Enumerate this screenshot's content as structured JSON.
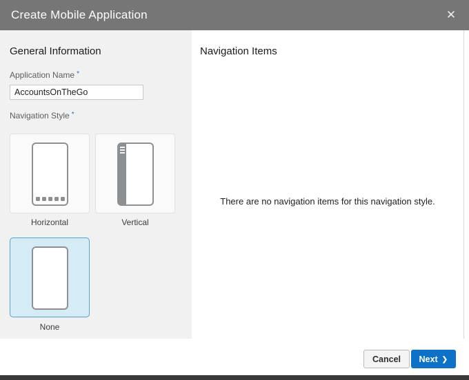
{
  "titlebar": {
    "title": "Create Mobile Application",
    "close_icon": "✕"
  },
  "general": {
    "heading": "General Information",
    "application_name": {
      "label": "Application Name",
      "required_marker": "*",
      "value": "AccountsOnTheGo"
    },
    "navigation_style": {
      "label": "Navigation Style",
      "required_marker": "*",
      "options": [
        {
          "label": "Horizontal",
          "selected": false
        },
        {
          "label": "Vertical",
          "selected": false
        },
        {
          "label": "None",
          "selected": true
        }
      ]
    }
  },
  "navigation_items": {
    "heading": "Navigation Items",
    "empty_message": "There are no navigation items for this navigation style."
  },
  "footer": {
    "cancel_label": "Cancel",
    "next_label": "Next",
    "next_chevron": "❯"
  },
  "colors": {
    "titlebar_bg": "#767676",
    "left_panel_bg": "#f1f1f1",
    "accent_blue": "#0c71c7",
    "selected_card_bg": "#d5ecf7",
    "selected_card_border": "#55a3cb",
    "required_marker_blue": "#2a6fb5"
  }
}
